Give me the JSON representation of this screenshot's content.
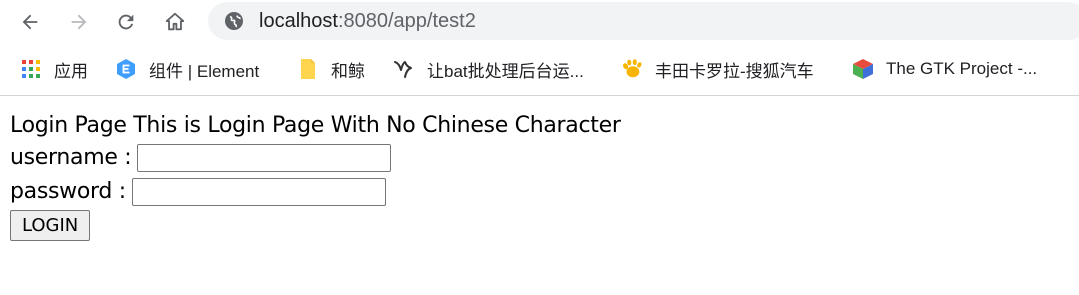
{
  "browser": {
    "url_host": "localhost",
    "url_rest": ":8080/app/test2",
    "icons": {
      "back": "back-arrow-icon",
      "forward": "forward-arrow-icon",
      "reload": "reload-icon",
      "home": "home-icon",
      "site_info": "globe-icon"
    }
  },
  "bookmarks": [
    {
      "label": "应用",
      "icon": "apps-grid-icon"
    },
    {
      "label": "组件 | Element",
      "icon": "element-logo-icon"
    },
    {
      "label": "和鲸",
      "icon": "folder-icon"
    },
    {
      "label": "让bat批处理后台运...",
      "icon": "bat-site-icon"
    },
    {
      "label": "丰田卡罗拉-搜狐汽车",
      "icon": "paw-icon"
    },
    {
      "label": "The GTK Project -...",
      "icon": "gtk-cube-icon"
    }
  ],
  "page": {
    "title": "Login Page This is Login Page With No Chinese Character",
    "username_label": "username :",
    "username_value": "",
    "password_label": "password :",
    "password_value": "",
    "login_button": "LOGIN"
  }
}
